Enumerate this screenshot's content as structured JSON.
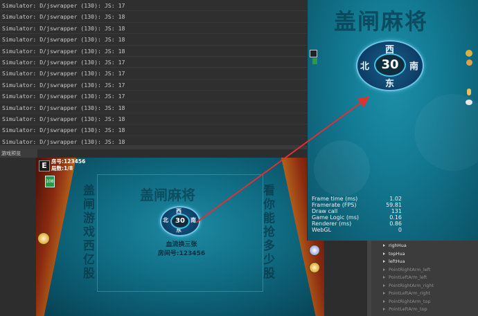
{
  "console": {
    "lines": [
      "Simulator: D/jswrapper (130): JS: 17",
      "Simulator: D/jswrapper (130): JS: 18",
      "Simulator: D/jswrapper (130): JS: 18",
      "Simulator: D/jswrapper (130): JS: 18",
      "Simulator: D/jswrapper (130): JS: 18",
      "Simulator: D/jswrapper (130): JS: 17",
      "Simulator: D/jswrapper (130): JS: 17",
      "Simulator: D/jswrapper (130): JS: 17",
      "Simulator: D/jswrapper (130): JS: 17",
      "Simulator: D/jswrapper (130): JS: 18",
      "Simulator: D/jswrapper (130): JS: 18",
      "Simulator: D/jswrapper (130): JS: 18",
      "Simulator: D/jswrapper (130): JS: 18"
    ]
  },
  "preview": {
    "tab_label": "游戏预览",
    "room_badge": "E",
    "room_number": "房号:123456",
    "round_count": "局数:1/8",
    "card_count": "108",
    "title_watermark": "盖闸麻将",
    "left_column": "盖闸游戏西亿股",
    "right_column": "看你能抢多少股",
    "compass_number": "30",
    "dir_north": "西",
    "dir_west": "北",
    "dir_east": "南",
    "dir_south": "东",
    "game_mode": "血流换三张",
    "room_label": "房间号:123456"
  },
  "zoom": {
    "title_watermark": "盖闸麻将",
    "compass_number": "30",
    "dir_north": "西",
    "dir_west": "北",
    "dir_east": "南",
    "dir_south": "东",
    "stats": [
      {
        "label": "Frame time (ms)",
        "value": "1.02"
      },
      {
        "label": "Framerate (FPS)",
        "value": "59.81"
      },
      {
        "label": "Draw call",
        "value": "131"
      },
      {
        "label": "Game Logic (ms)",
        "value": "0.16"
      },
      {
        "label": "Renderer (ms)",
        "value": "0.86"
      },
      {
        "label": "WebGL",
        "value": "0"
      }
    ]
  },
  "hierarchy": {
    "items": [
      {
        "label": "righHua",
        "active": true
      },
      {
        "label": "topHua",
        "active": true
      },
      {
        "label": "leftHua",
        "active": true
      },
      {
        "label": "PointRightArm_left",
        "active": false
      },
      {
        "label": "PointLeftArm_left",
        "active": false
      },
      {
        "label": "PointRightArm_right",
        "active": false
      },
      {
        "label": "PointLeftArm_right",
        "active": false
      },
      {
        "label": "PointRightArm_top",
        "active": false
      },
      {
        "label": "PointLeftArm_top",
        "active": false
      }
    ]
  },
  "colors": {
    "arrow": "#e03030",
    "table_teal": "#0f6b82",
    "console_bg": "#2f2f2f"
  }
}
